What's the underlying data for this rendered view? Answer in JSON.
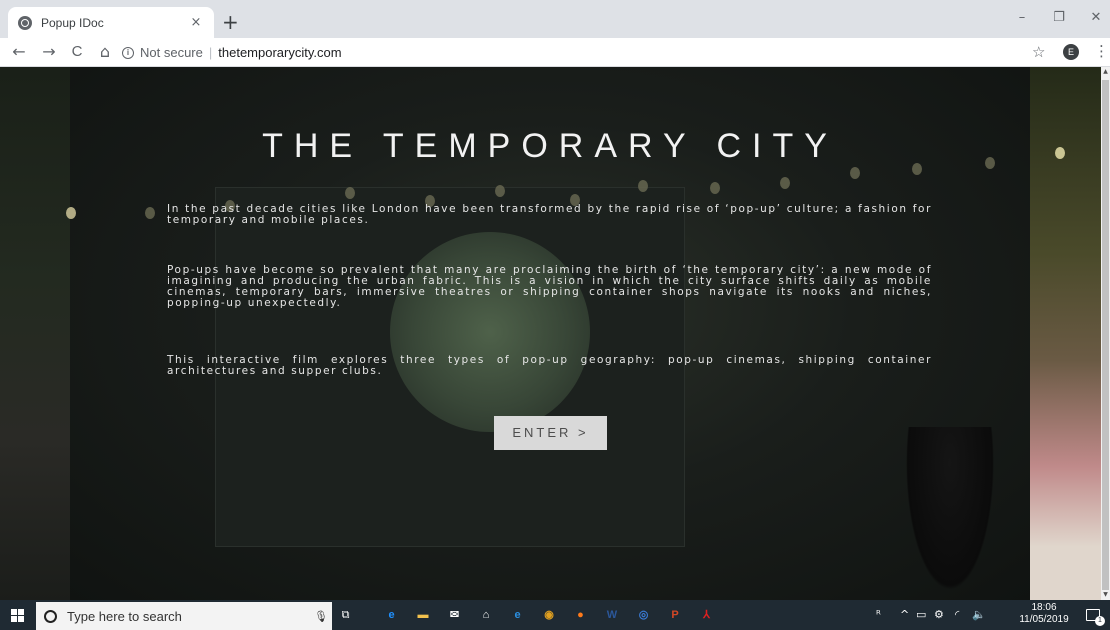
{
  "browser": {
    "tab_title": "Popup IDoc",
    "tab_close": "×",
    "new_tab": "+",
    "window_controls": {
      "minimize": "–",
      "restore": "❐",
      "close": "✕"
    },
    "nav": {
      "back": "←",
      "forward": "→",
      "reload": "C",
      "home": "⌂"
    },
    "address": {
      "info": "i",
      "security_label": "Not secure",
      "separator": "|",
      "url": "thetemporarycity.com"
    },
    "star": "☆",
    "profile_initial": "E",
    "menu": "⋮"
  },
  "page": {
    "title": "THE TEMPORARY CITY",
    "paragraphs": [
      "In the past decade cities like London have been transformed by the rapid rise of ‘pop-up’ culture; a fashion for temporary and mobile places.",
      "Pop-ups have become so prevalent that many are proclaiming the birth of ‘the temporary city’: a new mode of imagining and producing the urban fabric. This is a vision in which the city surface shifts daily as mobile cinemas, temporary bars, immersive theatres or shipping container shops navigate its nooks and niches, popping-up unexpectedly.",
      "This interactive film explores three types of pop-up geography: pop-up cinemas, shipping container architectures and supper clubs."
    ],
    "enter_button": "ENTER >"
  },
  "scrollbar": {
    "up": "▲",
    "down": "▼"
  },
  "taskbar": {
    "search_placeholder": "Type here to search",
    "mic": "🎙",
    "task_view": "⧉",
    "apps": [
      {
        "name": "edge-icon",
        "glyph": "e",
        "color": "#1e90ff"
      },
      {
        "name": "file-explorer-icon",
        "glyph": "▬",
        "color": "#f2c14e"
      },
      {
        "name": "mail-icon",
        "glyph": "✉",
        "color": "#ffffff"
      },
      {
        "name": "store-icon",
        "glyph": "⌂",
        "color": "#ffffff"
      },
      {
        "name": "internet-explorer-icon",
        "glyph": "e",
        "color": "#2a8fe0"
      },
      {
        "name": "chrome-icon",
        "glyph": "◉",
        "color": "#e0a020"
      },
      {
        "name": "firefox-icon",
        "glyph": "●",
        "color": "#ff7a1a"
      },
      {
        "name": "word-icon",
        "glyph": "W",
        "color": "#2b579a"
      },
      {
        "name": "app-icon",
        "glyph": "◎",
        "color": "#3a7bd5"
      },
      {
        "name": "powerpoint-icon",
        "glyph": "P",
        "color": "#d24726"
      },
      {
        "name": "acrobat-icon",
        "glyph": "⅄",
        "color": "#e02020"
      }
    ],
    "tray": {
      "people": "ᴿ",
      "chevron": "^",
      "battery": "▭",
      "network": "⚙",
      "wifi": "◜",
      "volume": "🔈"
    },
    "time": "18:06",
    "date": "11/05/2019",
    "notification_count": "1"
  }
}
